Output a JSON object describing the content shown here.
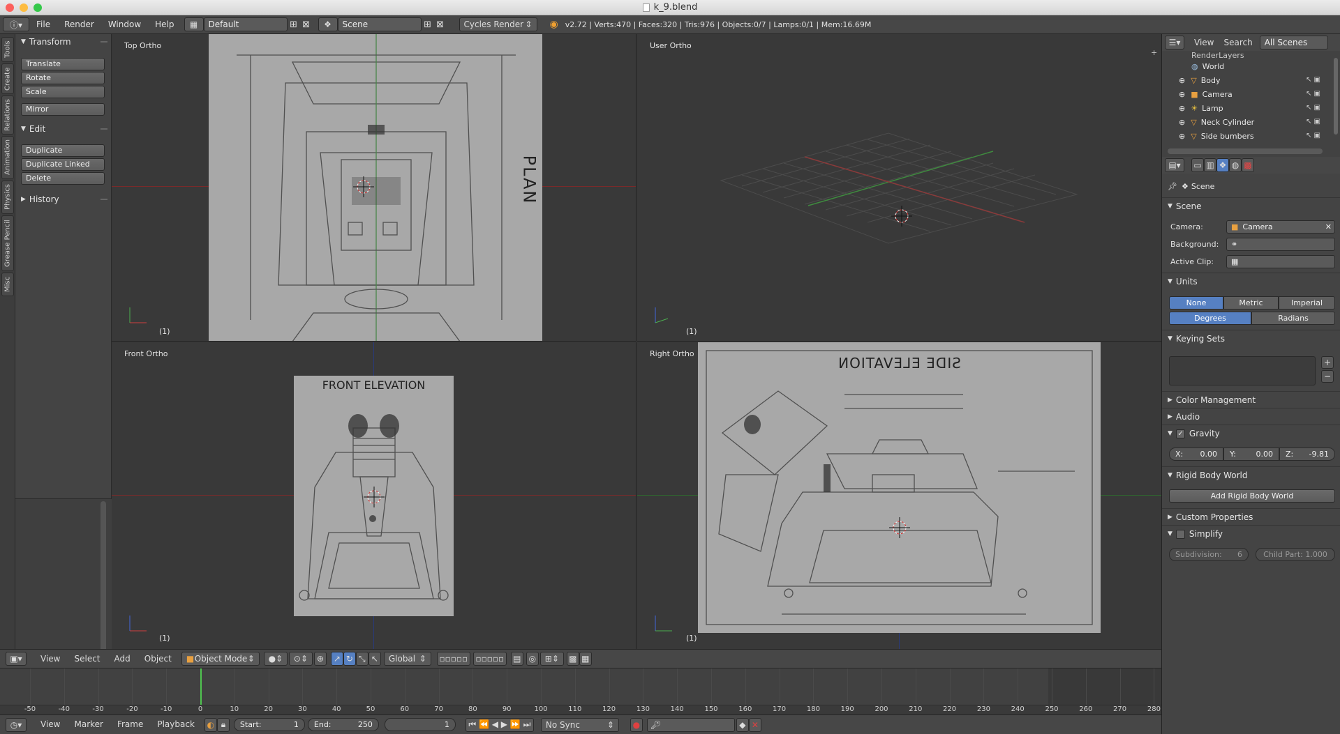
{
  "window": {
    "title": "k_9.blend"
  },
  "info": {
    "menus": [
      "File",
      "Render",
      "Window",
      "Help"
    ],
    "layout": "Default",
    "scene": "Scene",
    "engine": "Cycles Render",
    "stats": "v2.72 | Verts:470 | Faces:320 | Tris:976 | Objects:0/7 | Lamps:0/1 | Mem:16.69M"
  },
  "tabs": [
    "Tools",
    "Create",
    "Relations",
    "Animation",
    "Physics",
    "Grease Pencil",
    "Misc"
  ],
  "toolshelf": {
    "transform": "Transform",
    "translate": "Translate",
    "rotate": "Rotate",
    "scale": "Scale",
    "mirror": "Mirror",
    "edit": "Edit",
    "duplicate": "Duplicate",
    "duplicate_linked": "Duplicate Linked",
    "delete": "Delete",
    "history": "History"
  },
  "viewports": {
    "top": "Top Ortho",
    "user": "User Ortho",
    "front": "Front Ortho",
    "right": "Right Ortho",
    "layer": "(1)",
    "plan": "PLAN",
    "front_elev": "FRONT ELEVATION",
    "side_elev": "SIDE ELEVATION"
  },
  "vpheader": {
    "menus": [
      "View",
      "Select",
      "Add",
      "Object"
    ],
    "mode": "Object Mode",
    "orientation": "Global"
  },
  "timeline": {
    "ticks": [
      -50,
      -40,
      -30,
      -20,
      -10,
      0,
      10,
      20,
      30,
      40,
      50,
      60,
      70,
      80,
      90,
      100,
      110,
      120,
      130,
      140,
      150,
      160,
      170,
      180,
      190,
      200,
      210,
      220,
      230,
      240,
      250,
      260,
      270,
      280
    ],
    "menus": [
      "View",
      "Marker",
      "Frame",
      "Playback"
    ],
    "start_label": "Start:",
    "start": "1",
    "end_label": "End:",
    "end": "250",
    "current": "1",
    "sync": "No Sync"
  },
  "outliner": {
    "menus": [
      "View",
      "Search"
    ],
    "filter": "All Scenes",
    "items": [
      "RenderLayers",
      "World",
      "Body",
      "Camera",
      "Lamp",
      "Neck Cylinder",
      "Side bumbers"
    ]
  },
  "properties": {
    "breadcrumb": "Scene",
    "scene_panel": "Scene",
    "camera_label": "Camera:",
    "camera": "Camera",
    "background_label": "Background:",
    "active_clip_label": "Active Clip:",
    "units_panel": "Units",
    "unit_none": "None",
    "unit_metric": "Metric",
    "unit_imperial": "Imperial",
    "rot_degrees": "Degrees",
    "rot_radians": "Radians",
    "keying_panel": "Keying Sets",
    "color_mgmt": "Color Management",
    "audio": "Audio",
    "gravity": "Gravity",
    "gx_label": "X:",
    "gx": "0.00",
    "gy_label": "Y:",
    "gy": "0.00",
    "gz_label": "Z:",
    "gz": "-9.81",
    "rigid_panel": "Rigid Body World",
    "add_rigid": "Add Rigid Body World",
    "custom_props": "Custom Properties",
    "simplify": "Simplify",
    "subdivision_label": "Subdivision:",
    "subdivision": "6",
    "child_part": "Child Part: 1.000"
  },
  "colors": {
    "accent": "#5680c2",
    "header": "#474747",
    "viewport": "#393939"
  }
}
